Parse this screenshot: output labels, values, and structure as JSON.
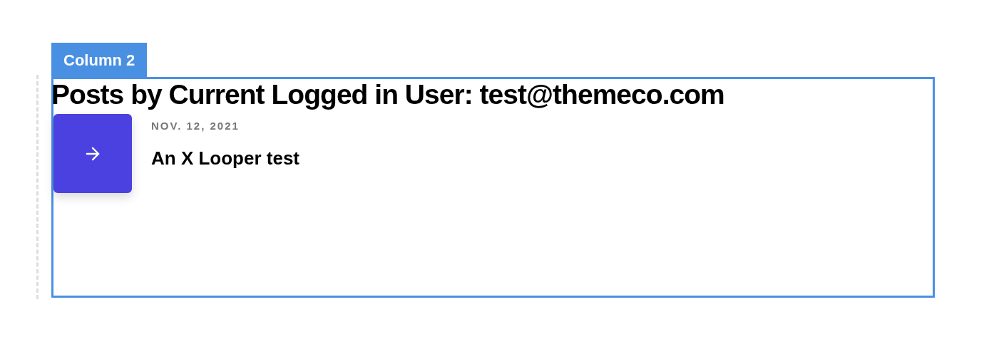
{
  "column_tag": "Column 2",
  "heading": "Posts by Current Logged in User: test@themeco.com",
  "posts": [
    {
      "date": "NOV. 12, 2021",
      "title": "An X Looper test"
    }
  ]
}
